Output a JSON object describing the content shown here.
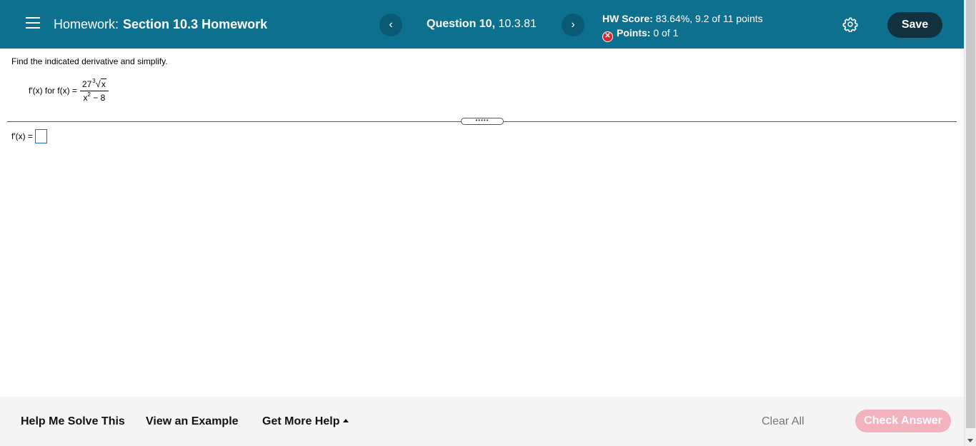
{
  "header": {
    "homework_label": "Homework:",
    "homework_title": "Section 10.3 Homework",
    "question_label": "Question 10,",
    "question_id": "10.3.81",
    "prev_symbol": "‹",
    "next_symbol": "›",
    "hw_score_label": "HW Score:",
    "hw_score_value": "83.64%, 9.2 of 11 points",
    "points_label": "Points:",
    "points_value": "0 of 1",
    "save_label": "Save",
    "colors": {
      "bar": "#0d708f",
      "save": "#11313f",
      "error": "#d9262b"
    }
  },
  "question": {
    "instruction": "Find the indicated derivative and simplify.",
    "prompt_prefix": "f′(x) for f(x) =",
    "numerator_coeff": "27",
    "root_index": "3",
    "radicand": "x",
    "denominator_base": "x",
    "denominator_exp": "2",
    "denominator_rest": " − 8",
    "drag_handle": "•••••",
    "answer_label": "f′(x) ="
  },
  "footer": {
    "help_solve": "Help Me Solve This",
    "view_example": "View an Example",
    "more_help": "Get More Help",
    "clear_all": "Clear All",
    "check_answer": "Check Answer",
    "colors": {
      "check_answer_disabled": "#f2b3bd"
    }
  }
}
